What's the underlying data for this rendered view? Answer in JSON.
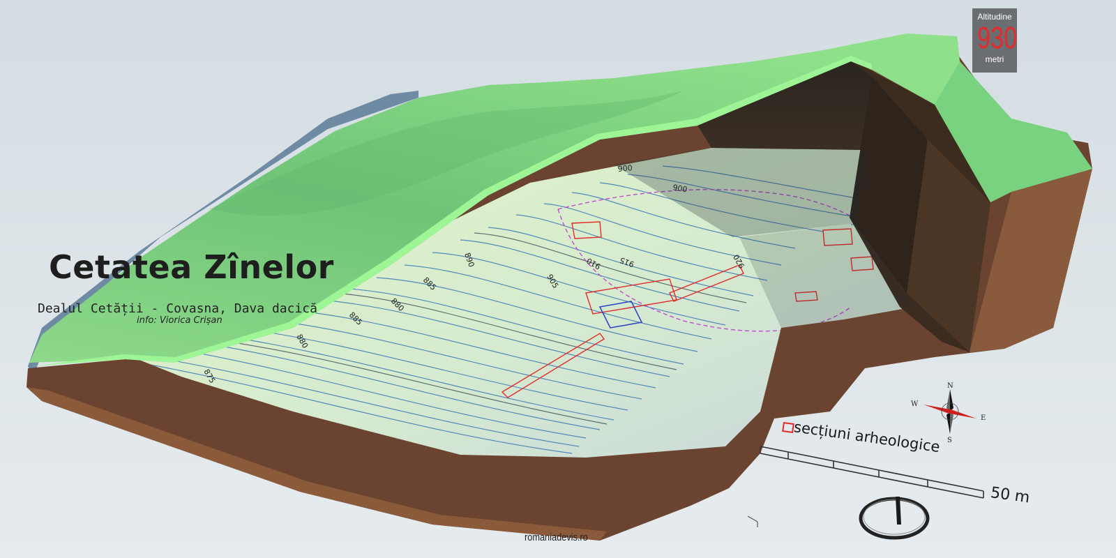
{
  "title": "Cetatea Zînelor",
  "subtitle": "Dealul Cetății - Covasna, Dava dacică",
  "credit": "info: Viorica Crișan",
  "altitude": {
    "label": "Altitudine",
    "value": "930",
    "unit": "metri"
  },
  "legend": {
    "label": "secțiuni arheologice"
  },
  "scale": {
    "label": "50 m"
  },
  "compass": {
    "n": "N",
    "s": "S",
    "e": "E",
    "w": "W"
  },
  "contour_labels": [
    "875",
    "880",
    "885",
    "880",
    "885",
    "890",
    "905",
    "910",
    "915",
    "920",
    "900",
    "900"
  ],
  "website": "romaniadevis.ro",
  "colors": {
    "grass": "#7fcf7f",
    "soil": "#6a4431",
    "accent": "#e32b2b",
    "contour": "#3a78b5"
  }
}
